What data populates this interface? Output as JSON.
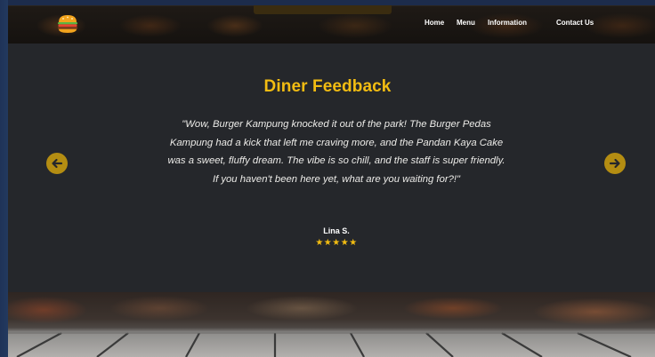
{
  "nav": {
    "logo_icon": "burger-icon",
    "links": [
      {
        "label": "Home"
      },
      {
        "label": "Menu"
      },
      {
        "label": "Information"
      },
      {
        "label": "Contact Us"
      }
    ]
  },
  "feedback": {
    "title": "Diner Feedback",
    "quote": "\"Wow, Burger Kampung knocked it out of the park! The Burger Pedas Kampung had a kick that left me craving more, and the Pandan Kaya Cake was a sweet, fluffy dream. The vibe is so chill, and the staff is super friendly. If you haven't been here yet, what are you waiting for?!\"",
    "author": "Lina S.",
    "stars": "★★★★★",
    "rating": 5,
    "prev_icon": "arrow-left-circle-icon",
    "next_icon": "arrow-right-circle-icon"
  },
  "colors": {
    "accent": "#f2bc12",
    "panel_bg": "#25272b",
    "arrow_bg": "#b48d12"
  }
}
